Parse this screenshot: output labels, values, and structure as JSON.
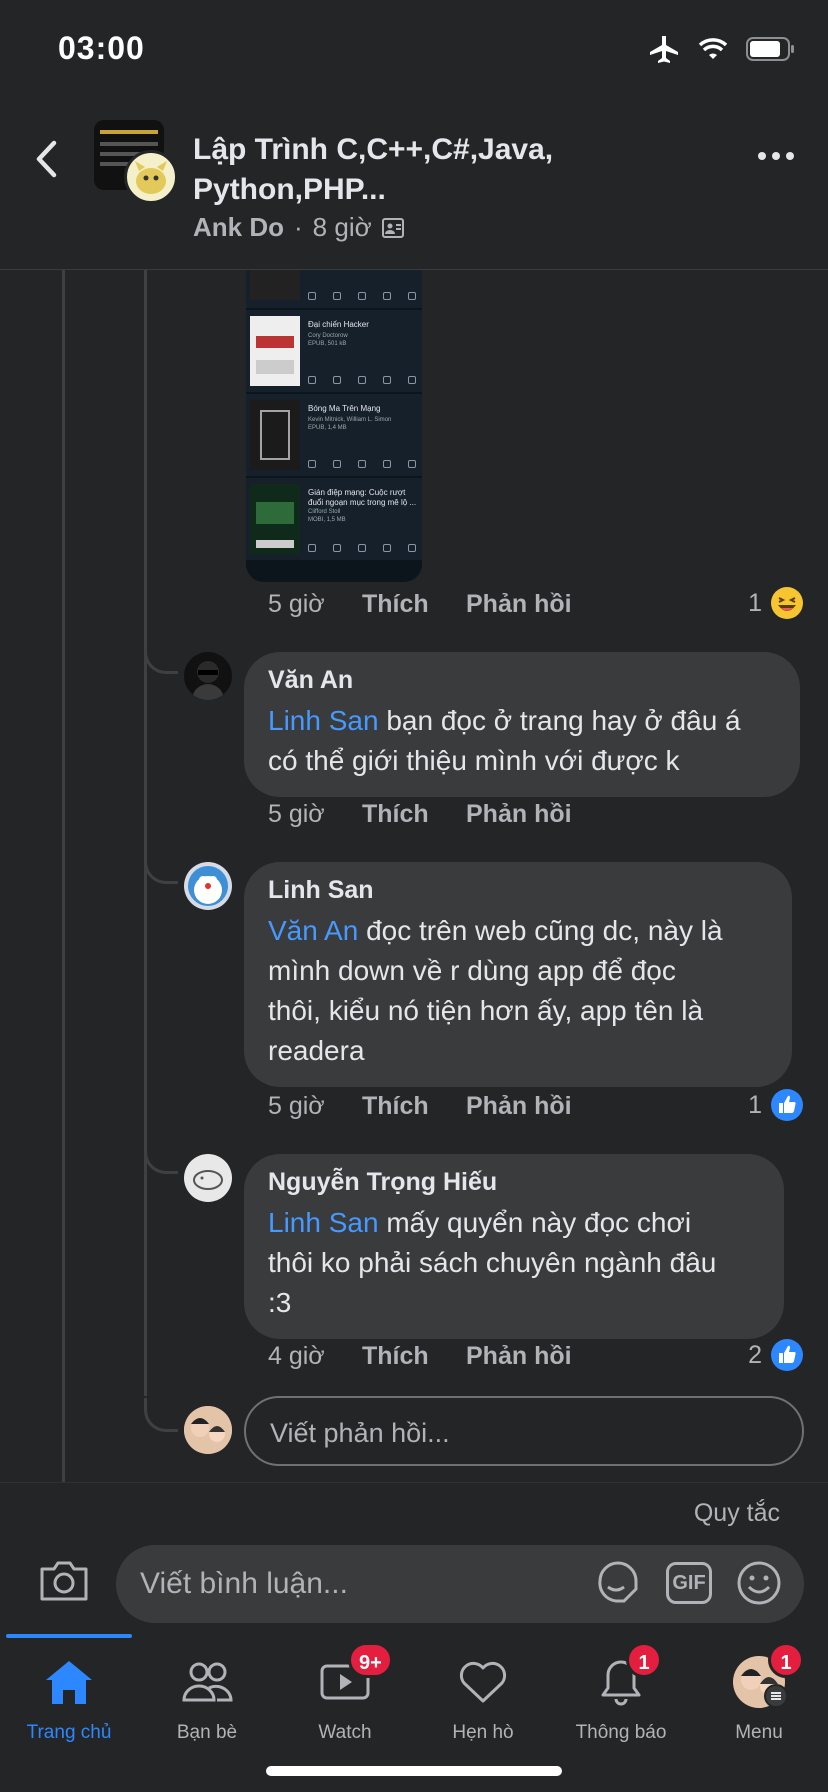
{
  "status_bar": {
    "time": "03:00"
  },
  "header": {
    "group_title": "Lập Trình C,C++,C#,Java, Python,PHP...",
    "author": "Ank Do",
    "separator": "·",
    "post_time": "8 giờ"
  },
  "screenshot_books": [
    {
      "title": "Đại chiến Hacker",
      "meta": "Cory Doctorow\nEPUB, 501 kB"
    },
    {
      "title": "Bóng Ma Trên Mạng",
      "meta": "Kevin Mitnick, William L. Simon\nEPUB, 1,4 MB"
    },
    {
      "title": "Gián điệp mạng: Cuộc rượt đuổi ngoạn mục trong mê lộ ...",
      "meta": "Clifford Stoll\nMOBI, 1,5 MB"
    }
  ],
  "labels": {
    "like": "Thích",
    "reply": "Phản hồi"
  },
  "image_comment_actions": {
    "time": "5 giờ",
    "reaction_count": "1"
  },
  "comments": [
    {
      "name": "Văn An",
      "mention": "Linh San",
      "text_line1": " bạn đọc ở trang hay ở đâu á",
      "text_line2": "có thể giới thiệu mình với được k",
      "time": "5 giờ",
      "reaction_count": ""
    },
    {
      "name": "Linh San",
      "mention": "Văn An",
      "text_line1": " đọc trên web cũng dc, này là",
      "text_line2": "mình down về r dùng app để đọc",
      "text_line3": "thôi, kiểu nó tiện hơn ấy, app tên là",
      "text_line4": "readera",
      "time": "5 giờ",
      "reaction_count": "1"
    },
    {
      "name": "Nguyễn Trọng Hiếu",
      "mention": "Linh San",
      "text_line1": " mấy quyển này đọc chơi",
      "text_line2": "thôi ko phải sách chuyên ngành đâu",
      "text_line3": ":3",
      "time": "4 giờ",
      "reaction_count": "2"
    }
  ],
  "reply_input": {
    "placeholder": "Viết phản hồi..."
  },
  "composer": {
    "rules": "Quy tắc",
    "placeholder": "Viết bình luận...",
    "gif": "GIF"
  },
  "tabs": [
    {
      "label": "Trang chủ",
      "badge": ""
    },
    {
      "label": "Bạn bè",
      "badge": ""
    },
    {
      "label": "Watch",
      "badge": "9+"
    },
    {
      "label": "Hẹn hò",
      "badge": ""
    },
    {
      "label": "Thông báo",
      "badge": "1"
    },
    {
      "label": "Menu",
      "badge": "1"
    }
  ],
  "colors": {
    "background": "#242526",
    "bubble": "#3a3b3c",
    "mention": "#4599ff",
    "accent": "#2d88ff",
    "badge": "#e41e3f"
  }
}
